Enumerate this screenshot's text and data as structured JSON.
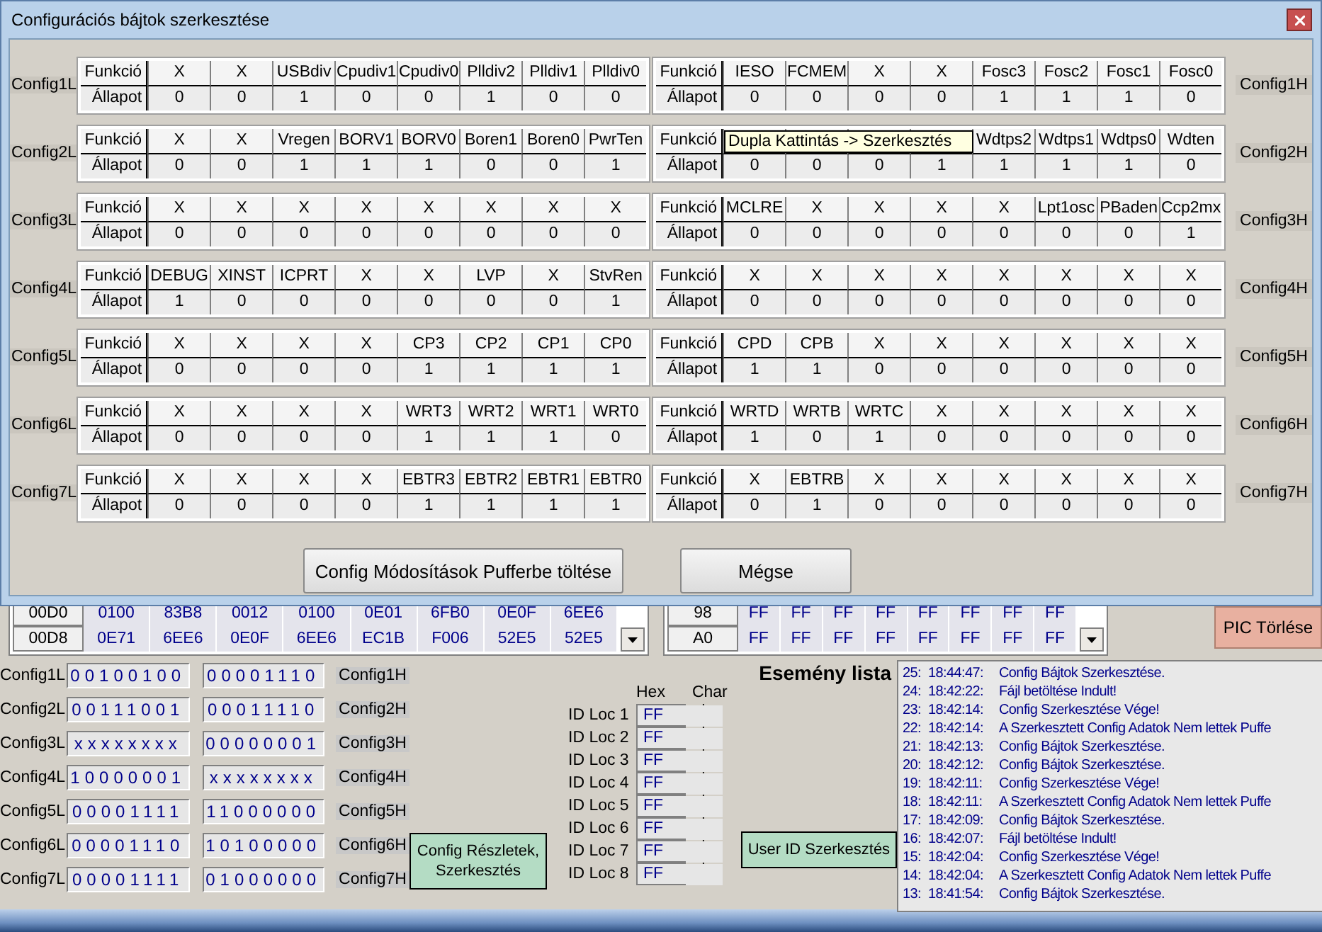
{
  "dialog": {
    "title": "Configurációs bájtok szerkesztése",
    "config_rows": [
      {
        "left": {
          "label": "Config1L",
          "row_titles": [
            "Funkció",
            "Állapot"
          ],
          "functions": [
            "X",
            "X",
            "USBdiv",
            "Cpudiv1",
            "Cpudiv0",
            "Plldiv2",
            "Plldiv1",
            "Plldiv0"
          ],
          "states": [
            "0",
            "0",
            "1",
            "0",
            "0",
            "1",
            "0",
            "0"
          ]
        },
        "right": {
          "label": "Config1H",
          "row_titles": [
            "Funkció",
            "Állapot"
          ],
          "functions": [
            "IESO",
            "FCMEM",
            "X",
            "X",
            "Fosc3",
            "Fosc2",
            "Fosc1",
            "Fosc0"
          ],
          "states": [
            "0",
            "0",
            "0",
            "0",
            "1",
            "1",
            "1",
            "0"
          ]
        }
      },
      {
        "left": {
          "label": "Config2L",
          "row_titles": [
            "Funkció",
            "Állapot"
          ],
          "functions": [
            "X",
            "X",
            "Vregen",
            "BORV1",
            "BORV0",
            "Boren1",
            "Boren0",
            "PwrTen"
          ],
          "states": [
            "0",
            "0",
            "1",
            "1",
            "1",
            "0",
            "0",
            "1"
          ]
        },
        "right": {
          "label": "Config2H",
          "row_titles": [
            "Funkció",
            "Állapot"
          ],
          "functions": [
            "Wdtps2",
            "Wdtps1",
            "Wdtps0",
            "Wdten"
          ],
          "states": [
            "0",
            "0",
            "0",
            "1",
            "1",
            "1",
            "1",
            "0"
          ],
          "tooltip": "Dupla Kattintás -> Szerkesztés"
        }
      },
      {
        "left": {
          "label": "Config3L",
          "row_titles": [
            "Funkció",
            "Állapot"
          ],
          "functions": [
            "X",
            "X",
            "X",
            "X",
            "X",
            "X",
            "X",
            "X"
          ],
          "states": [
            "0",
            "0",
            "0",
            "0",
            "0",
            "0",
            "0",
            "0"
          ]
        },
        "right": {
          "label": "Config3H",
          "row_titles": [
            "Funkció",
            "Állapot"
          ],
          "functions": [
            "MCLRE",
            "X",
            "X",
            "X",
            "X",
            "Lpt1osc",
            "PBaden",
            "Ccp2mx"
          ],
          "states": [
            "0",
            "0",
            "0",
            "0",
            "0",
            "0",
            "0",
            "1"
          ]
        }
      },
      {
        "left": {
          "label": "Config4L",
          "row_titles": [
            "Funkció",
            "Állapot"
          ],
          "functions": [
            "DEBUG",
            "XINST",
            "ICPRT",
            "X",
            "X",
            "LVP",
            "X",
            "StvRen"
          ],
          "states": [
            "1",
            "0",
            "0",
            "0",
            "0",
            "0",
            "0",
            "1"
          ]
        },
        "right": {
          "label": "Config4H",
          "row_titles": [
            "Funkció",
            "Állapot"
          ],
          "functions": [
            "X",
            "X",
            "X",
            "X",
            "X",
            "X",
            "X",
            "X"
          ],
          "states": [
            "0",
            "0",
            "0",
            "0",
            "0",
            "0",
            "0",
            "0"
          ]
        }
      },
      {
        "left": {
          "label": "Config5L",
          "row_titles": [
            "Funkció",
            "Állapot"
          ],
          "functions": [
            "X",
            "X",
            "X",
            "X",
            "CP3",
            "CP2",
            "CP1",
            "CP0"
          ],
          "states": [
            "0",
            "0",
            "0",
            "0",
            "1",
            "1",
            "1",
            "1"
          ]
        },
        "right": {
          "label": "Config5H",
          "row_titles": [
            "Funkció",
            "Állapot"
          ],
          "functions": [
            "CPD",
            "CPB",
            "X",
            "X",
            "X",
            "X",
            "X",
            "X"
          ],
          "states": [
            "1",
            "1",
            "0",
            "0",
            "0",
            "0",
            "0",
            "0"
          ]
        }
      },
      {
        "left": {
          "label": "Config6L",
          "row_titles": [
            "Funkció",
            "Állapot"
          ],
          "functions": [
            "X",
            "X",
            "X",
            "X",
            "WRT3",
            "WRT2",
            "WRT1",
            "WRT0"
          ],
          "states": [
            "0",
            "0",
            "0",
            "0",
            "1",
            "1",
            "1",
            "0"
          ]
        },
        "right": {
          "label": "Config6H",
          "row_titles": [
            "Funkció",
            "Állapot"
          ],
          "functions": [
            "WRTD",
            "WRTB",
            "WRTC",
            "X",
            "X",
            "X",
            "X",
            "X"
          ],
          "states": [
            "1",
            "0",
            "1",
            "0",
            "0",
            "0",
            "0",
            "0"
          ]
        }
      },
      {
        "left": {
          "label": "Config7L",
          "row_titles": [
            "Funkció",
            "Állapot"
          ],
          "functions": [
            "X",
            "X",
            "X",
            "X",
            "EBTR3",
            "EBTR2",
            "EBTR1",
            "EBTR0"
          ],
          "states": [
            "0",
            "0",
            "0",
            "0",
            "1",
            "1",
            "1",
            "1"
          ]
        },
        "right": {
          "label": "Config7H",
          "row_titles": [
            "Funkció",
            "Állapot"
          ],
          "functions": [
            "X",
            "EBTRB",
            "X",
            "X",
            "X",
            "X",
            "X",
            "X"
          ],
          "states": [
            "0",
            "1",
            "0",
            "0",
            "0",
            "0",
            "0",
            "0"
          ]
        }
      }
    ],
    "buttons": [
      "Config Módosítások Pufferbe töltése",
      "Mégse"
    ]
  },
  "memory_table": {
    "rows": [
      [
        "00D0",
        "0100",
        "83B8",
        "0012",
        "0100",
        "0E01",
        "6FB0",
        "0E0F",
        "6EE6"
      ],
      [
        "00D8",
        "0E71",
        "6EE6",
        "0E0F",
        "6EE6",
        "EC1B",
        "F006",
        "52E5",
        "52E5"
      ]
    ]
  },
  "id_table": {
    "rows": [
      [
        "98",
        "FF",
        "FF",
        "FF",
        "FF",
        "FF",
        "FF",
        "FF",
        "FF"
      ],
      [
        "A0",
        "FF",
        "FF",
        "FF",
        "FF",
        "FF",
        "FF",
        "FF",
        "FF"
      ]
    ]
  },
  "pic_erase_button": "PIC Törlése",
  "config_values": [
    {
      "low_label": "Config1L",
      "low": "00100100",
      "high": "00001110",
      "high_label": "Config1H"
    },
    {
      "low_label": "Config2L",
      "low": "00111001",
      "high": "00011110",
      "high_label": "Config2H"
    },
    {
      "low_label": "Config3L",
      "low": "xxxxxxxx",
      "high": "00000001",
      "high_label": "Config3H"
    },
    {
      "low_label": "Config4L",
      "low": "10000001",
      "high": "xxxxxxxx",
      "high_label": "Config4H"
    },
    {
      "low_label": "Config5L",
      "low": "00001111",
      "high": "11000000",
      "high_label": "Config5H"
    },
    {
      "low_label": "Config6L",
      "low": "00001110",
      "high": "10100000",
      "high_label": "Config6H"
    },
    {
      "low_label": "Config7L",
      "low": "00001111",
      "high": "01000000",
      "high_label": "Config7H"
    }
  ],
  "config_details_button": "Config Részletek, Szerkesztés",
  "id_locations": {
    "headers": [
      "Hex",
      "Char"
    ],
    "rows": [
      {
        "label": "ID Loc 1",
        "hex": "FF",
        "char": "˙"
      },
      {
        "label": "ID Loc 2",
        "hex": "FF",
        "char": "˙"
      },
      {
        "label": "ID Loc 3",
        "hex": "FF",
        "char": "˙"
      },
      {
        "label": "ID Loc 4",
        "hex": "FF",
        "char": "˙"
      },
      {
        "label": "ID Loc 5",
        "hex": "FF",
        "char": "˙"
      },
      {
        "label": "ID Loc 6",
        "hex": "FF",
        "char": "˙"
      },
      {
        "label": "ID Loc 7",
        "hex": "FF",
        "char": "˙"
      },
      {
        "label": "ID Loc 8",
        "hex": "FF",
        "char": "˙"
      }
    ]
  },
  "user_id_button": "User ID Szerkesztés",
  "event_list": {
    "title": "Esemény lista",
    "items": [
      {
        "number": "25:",
        "time": "18:44:47:",
        "message": "Config Bájtok Szerkesztése."
      },
      {
        "number": "24:",
        "time": "18:42:22:",
        "message": "Fájl betöltése Indult!"
      },
      {
        "number": "23:",
        "time": "18:42:14:",
        "message": "Config Szerkesztése Vége!"
      },
      {
        "number": "22:",
        "time": "18:42:14:",
        "message": "A Szerkesztett Config Adatok Nem lettek Puffe"
      },
      {
        "number": "21:",
        "time": "18:42:13:",
        "message": "Config Bájtok Szerkesztése."
      },
      {
        "number": "20:",
        "time": "18:42:12:",
        "message": "Config Bájtok Szerkesztése."
      },
      {
        "number": "19:",
        "time": "18:42:11:",
        "message": "Config Szerkesztése Vége!"
      },
      {
        "number": "18:",
        "time": "18:42:11:",
        "message": "A Szerkesztett Config Adatok Nem lettek Puffe"
      },
      {
        "number": "17:",
        "time": "18:42:09:",
        "message": "Config Bájtok Szerkesztése."
      },
      {
        "number": "16:",
        "time": "18:42:07:",
        "message": "Fájl betöltése Indult!"
      },
      {
        "number": "15:",
        "time": "18:42:04:",
        "message": "Config Szerkesztése Vége!"
      },
      {
        "number": "14:",
        "time": "18:42:04:",
        "message": "A Szerkesztett Config Adatok Nem lettek Puffe"
      },
      {
        "number": "13:",
        "time": "18:41:54:",
        "message": "Config Bájtok Szerkesztése."
      }
    ]
  }
}
